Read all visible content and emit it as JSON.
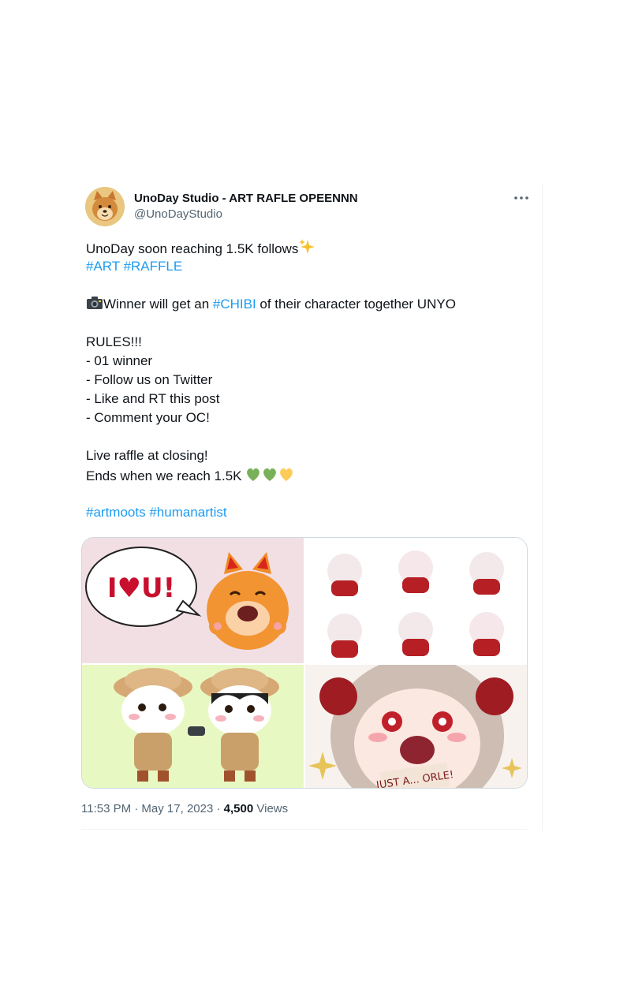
{
  "author": {
    "display_name": "UnoDay Studio - ART RAFLE OPEENNN",
    "handle": "@UnoDayStudio",
    "avatar_icon": "shiba-dog-avatar"
  },
  "more_icon": "more-horizontal-icon",
  "tweet": {
    "line1_text": "UnoDay soon reaching 1.5K follows",
    "line1_emoji": "✨",
    "tags1": [
      "#ART",
      "#RAFFLE"
    ],
    "line3_emoji": "📷",
    "line3_pre": "Winner will get an ",
    "line3_tag": "#CHIBI",
    "line3_post": " of their character together UNYO",
    "rules": [
      "RULES!!!",
      "- 01 winner",
      "- Follow us on Twitter",
      "- Like and RT this post",
      "- Comment your OC!"
    ],
    "closing": "Live raffle at closing!",
    "ends": "Ends when we reach 1.5K ",
    "ends_emoji": "💚💚💛",
    "tags2": [
      "#artmoots",
      "#humanartist"
    ]
  },
  "media": {
    "tile1_text": "I♥U!",
    "tile4_text": "JUST A... ORLE!"
  },
  "meta": {
    "time": "11:53 PM · May 17, 2023",
    "separator": " · ",
    "views_count": "4,500",
    "views_label": " Views"
  },
  "colors": {
    "link": "#1d9bf0",
    "secondary": "#536471",
    "primary": "#0f1419",
    "border": "#cfd9de"
  }
}
